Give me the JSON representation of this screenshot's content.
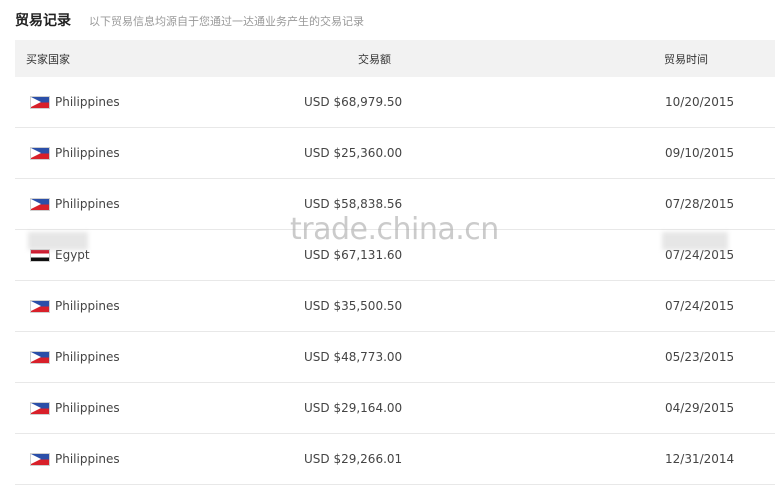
{
  "header": {
    "title": "贸易记录",
    "subtitle": "以下贸易信息均源自于您通过一达通业务产生的交易记录"
  },
  "table": {
    "columns": {
      "country": "买家国家",
      "amount": "交易额",
      "time": "贸易时间"
    },
    "rows": [
      {
        "country": "Philippines",
        "flag": "philippines-flag",
        "amount": "USD $68,979.50",
        "time": "10/20/2015"
      },
      {
        "country": "Philippines",
        "flag": "philippines-flag",
        "amount": "USD $25,360.00",
        "time": "09/10/2015"
      },
      {
        "country": "Philippines",
        "flag": "philippines-flag",
        "amount": "USD $58,838.56",
        "time": "07/28/2015"
      },
      {
        "country": "Egypt",
        "flag": "egypt-flag",
        "amount": "USD $67,131.60",
        "time": "07/24/2015"
      },
      {
        "country": "Philippines",
        "flag": "philippines-flag",
        "amount": "USD $35,500.50",
        "time": "07/24/2015"
      },
      {
        "country": "Philippines",
        "flag": "philippines-flag",
        "amount": "USD $48,773.00",
        "time": "05/23/2015"
      },
      {
        "country": "Philippines",
        "flag": "philippines-flag",
        "amount": "USD $29,164.00",
        "time": "04/29/2015"
      },
      {
        "country": "Philippines",
        "flag": "philippines-flag",
        "amount": "USD $29,266.01",
        "time": "12/31/2014"
      }
    ]
  },
  "watermark": "trade.china.cn"
}
